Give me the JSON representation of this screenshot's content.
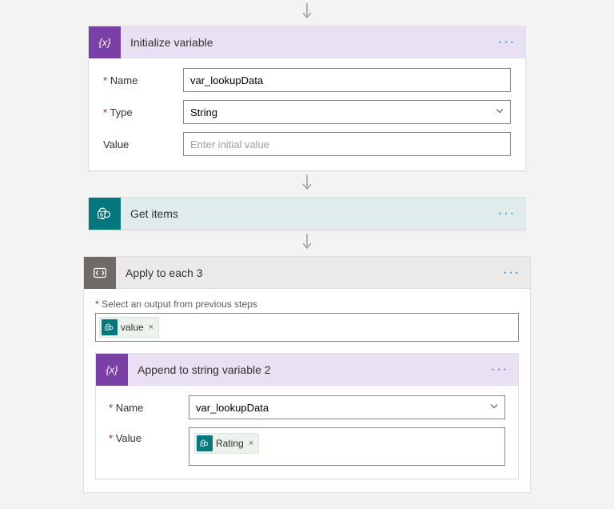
{
  "arrows": true,
  "steps": {
    "init_var": {
      "title": "Initialize variable",
      "fields": {
        "name_label": "Name",
        "name_value": "var_lookupData",
        "type_label": "Type",
        "type_value": "String",
        "value_label": "Value",
        "value_placeholder": "Enter initial value"
      }
    },
    "get_items": {
      "title": "Get items"
    },
    "apply_each": {
      "title": "Apply to each 3",
      "select_label": "Select an output from previous steps",
      "token_value": "value"
    },
    "append_str": {
      "title": "Append to string variable 2",
      "fields": {
        "name_label": "Name",
        "name_value": "var_lookupData",
        "value_label": "Value",
        "token_value": "Rating"
      }
    }
  },
  "menu_glyph": "···",
  "close_glyph": "×"
}
